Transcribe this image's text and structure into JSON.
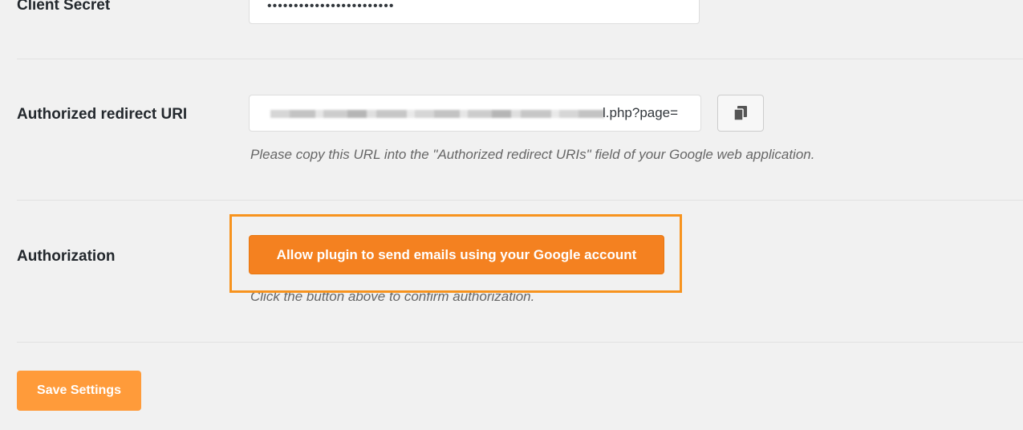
{
  "client_secret": {
    "label": "Client Secret",
    "value": "••••••••••••••••••••••••"
  },
  "redirect_uri": {
    "label": "Authorized redirect URI",
    "visible_value": "l.php?page=",
    "help": "Please copy this URL into the \"Authorized redirect URIs\" field of your Google web application.",
    "copy_icon": "copy-icon"
  },
  "authorization": {
    "label": "Authorization",
    "button_label": "Allow plugin to send emails using your Google account",
    "help": "Click the button above to confirm authorization."
  },
  "save_button_label": "Save Settings",
  "colors": {
    "accent": "#f48120",
    "highlight": "#f7931e",
    "save": "#ff9b3a"
  }
}
